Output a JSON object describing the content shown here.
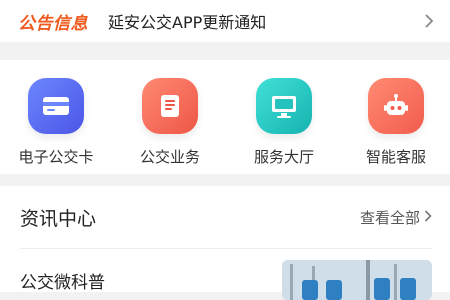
{
  "notice": {
    "badge": "公告信息",
    "title": "延安公交APP更新通知"
  },
  "actions": [
    {
      "label": "电子公交卡",
      "icon": "card-icon",
      "color": "#5b6ef0"
    },
    {
      "label": "公交业务",
      "icon": "document-icon",
      "color": "#f46a56"
    },
    {
      "label": "服务大厅",
      "icon": "monitor-icon",
      "color": "#23c4c0"
    },
    {
      "label": "智能客服",
      "icon": "robot-icon",
      "color": "#f5745e"
    }
  ],
  "news": {
    "header": "资讯中心",
    "view_all": "查看全部",
    "first_item_title": "公交微科普"
  }
}
